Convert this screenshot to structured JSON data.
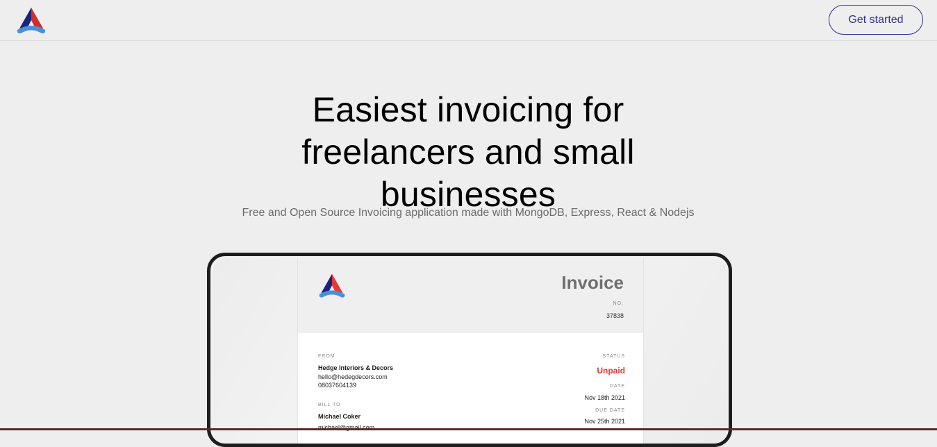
{
  "header": {
    "logo_icon": "app-logo-icon",
    "cta_label": "Get started"
  },
  "hero": {
    "title": "Easiest invoicing for freelancers and small businesses",
    "subtitle": "Free and Open Source Invoicing application made with MongoDB, Express, React & Nodejs"
  },
  "invoice_preview": {
    "title": "Invoice",
    "no_label": "NO:",
    "no_value": "37838",
    "from_label": "FROM",
    "from_name": "Hedge Interiors & Decors",
    "from_email": "hello@hedegdecors.com",
    "from_phone": "08037604139",
    "bill_to_label": "BILL TO",
    "bill_to_name": "Michael Coker",
    "bill_to_email": "michael@gmail.com",
    "status_label": "STATUS",
    "status_value": "Unpaid",
    "date_label": "DATE",
    "date_value": "Nov 18th 2021",
    "due_date_label": "DUE DATE",
    "due_date_value": "Nov 25th 2021"
  },
  "colors": {
    "accent": "#2e3192",
    "status_unpaid": "#e53935",
    "logo_red": "#e53935",
    "logo_blue": "#4a90d9",
    "logo_dark": "#1a237e"
  }
}
